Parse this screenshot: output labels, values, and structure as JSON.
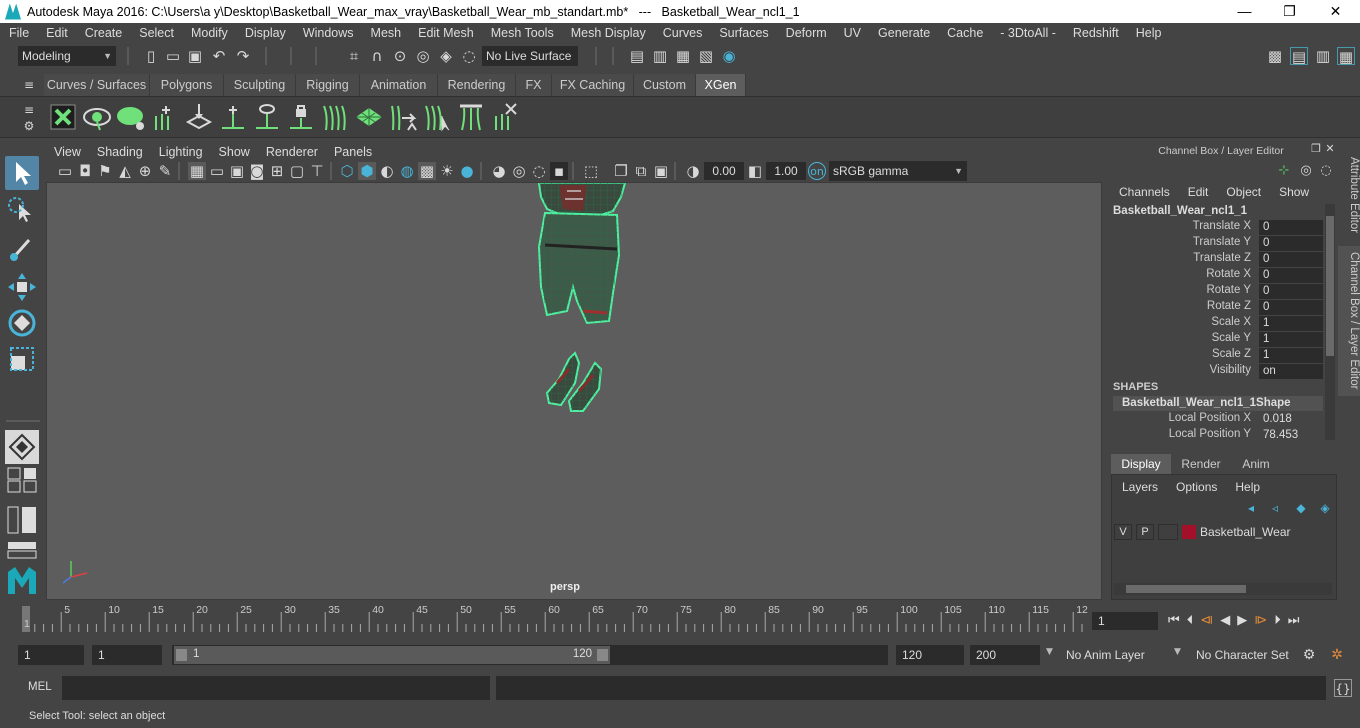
{
  "window": {
    "title": "Autodesk Maya 2016: C:\\Users\\a y\\Desktop\\Basketball_Wear_max_vray\\Basketball_Wear_mb_standart.mb*   ---   Basketball_Wear_ncl1_1",
    "minimize": "—",
    "maximize": "❐",
    "close": "✕"
  },
  "menus": [
    "File",
    "Edit",
    "Create",
    "Select",
    "Modify",
    "Display",
    "Windows",
    "Mesh",
    "Edit Mesh",
    "Mesh Tools",
    "Mesh Display",
    "Curves",
    "Surfaces",
    "Deform",
    "UV",
    "Generate",
    "Cache",
    "- 3DtoAll -",
    "Redshift",
    "Help"
  ],
  "status_line": {
    "mode": "Modeling",
    "live_surface": "No Live Surface"
  },
  "shelf_tabs": [
    "Curves / Surfaces",
    "Polygons",
    "Sculpting",
    "Rigging",
    "Animation",
    "Rendering",
    "FX",
    "FX Caching",
    "Custom",
    "XGen"
  ],
  "active_shelf": "XGen",
  "viewport": {
    "menus": [
      "View",
      "Shading",
      "Lighting",
      "Show",
      "Renderer",
      "Panels"
    ],
    "exposure": "0.00",
    "gamma": "1.00",
    "color_space": "sRGB gamma",
    "camera_label": "persp"
  },
  "channel_box": {
    "title": "Channel Box / Layer Editor",
    "menus": [
      "Channels",
      "Edit",
      "Object",
      "Show"
    ],
    "object_name": "Basketball_Wear_ncl1_1",
    "attributes": [
      {
        "label": "Translate X",
        "value": "0"
      },
      {
        "label": "Translate Y",
        "value": "0"
      },
      {
        "label": "Translate Z",
        "value": "0"
      },
      {
        "label": "Rotate X",
        "value": "0"
      },
      {
        "label": "Rotate Y",
        "value": "0"
      },
      {
        "label": "Rotate Z",
        "value": "0"
      },
      {
        "label": "Scale X",
        "value": "1"
      },
      {
        "label": "Scale Y",
        "value": "1"
      },
      {
        "label": "Scale Z",
        "value": "1"
      },
      {
        "label": "Visibility",
        "value": "on"
      }
    ],
    "shapes_header": "SHAPES",
    "shape_name": "Basketball_Wear_ncl1_1Shape",
    "shape_attributes": [
      {
        "label": "Local Position X",
        "value": "0.018"
      },
      {
        "label": "Local Position Y",
        "value": "78.453"
      }
    ]
  },
  "layer_editor": {
    "tabs": [
      "Display",
      "Render",
      "Anim"
    ],
    "active_tab": "Display",
    "menus": [
      "Layers",
      "Options",
      "Help"
    ],
    "layers": [
      {
        "v": "V",
        "p": "P",
        "name": "Basketball_Wear",
        "color": "#a3102a"
      }
    ]
  },
  "side_tabs": [
    "Attribute Editor",
    "Channel Box / Layer Editor"
  ],
  "timeline": {
    "ticks": [
      "1",
      "5",
      "10",
      "15",
      "20",
      "25",
      "30",
      "35",
      "40",
      "45",
      "50",
      "55",
      "60",
      "65",
      "70",
      "75",
      "80",
      "85",
      "90",
      "95",
      "100",
      "105",
      "110",
      "115",
      "12"
    ],
    "current_frame": "1"
  },
  "range": {
    "start": "1",
    "playback_start": "1",
    "slider_start": "1",
    "slider_end": "120",
    "playback_end": "120",
    "end": "200",
    "anim_layer": "No Anim Layer",
    "character_set": "No Character Set"
  },
  "command_line": {
    "language": "MEL"
  },
  "help_line": "Select Tool: select an object",
  "colors": {
    "accent": "#5285a6",
    "wireframe": "#4ef0a0",
    "layer_color": "#a3102a"
  }
}
